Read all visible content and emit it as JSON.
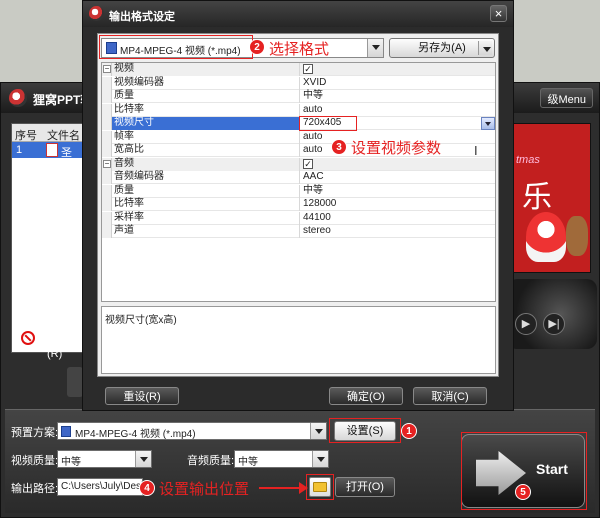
{
  "main": {
    "title": "狸窝PPT转",
    "menu_label": "级Menu",
    "file_list": {
      "columns": [
        "序号",
        "文件名"
      ],
      "rows": [
        {
          "index": "1",
          "name": "圣诞"
        }
      ]
    },
    "remove_label": "移除(R)",
    "preview": {
      "line1": "tmas",
      "line2": "乐"
    },
    "player": {
      "play": "▶",
      "next": "▶|"
    }
  },
  "bottom": {
    "preset_label": "预置方案:",
    "preset_value": "MP4-MPEG-4 视频 (*.mp4)",
    "settings_btn": "设置(S)",
    "video_quality_label": "视频质量:",
    "video_quality_value": "中等",
    "audio_quality_label": "音频质量:",
    "audio_quality_value": "中等",
    "output_path_label": "输出路径:",
    "output_path_value": "C:\\Users\\July\\Deskto",
    "open_btn": "打开(O)",
    "start_label": "Start"
  },
  "dialog": {
    "title": "输出格式设定",
    "close": "×",
    "format_value": "MP4-MPEG-4 视频 (*.mp4)",
    "saveas_label": "另存为(A)",
    "grid": [
      {
        "type": "cat",
        "name": "视频",
        "value": "✓"
      },
      {
        "type": "row",
        "name": "视频编码器",
        "value": "XVID"
      },
      {
        "type": "row",
        "name": "质量",
        "value": "中等"
      },
      {
        "type": "row",
        "name": "比特率",
        "value": "auto"
      },
      {
        "type": "sel",
        "name": "视频尺寸",
        "value": "720x405"
      },
      {
        "type": "row",
        "name": "帧率",
        "value": "auto"
      },
      {
        "type": "row",
        "name": "宽高比",
        "value": "auto"
      },
      {
        "type": "cat",
        "name": "音频",
        "value": "✓"
      },
      {
        "type": "row",
        "name": "音频编码器",
        "value": "AAC"
      },
      {
        "type": "row",
        "name": "质量",
        "value": "中等"
      },
      {
        "type": "row",
        "name": "比特率",
        "value": "128000"
      },
      {
        "type": "row",
        "name": "采样率",
        "value": "44100"
      },
      {
        "type": "row",
        "name": "声道",
        "value": "stereo"
      }
    ],
    "description": "视频尺寸(宽x高)",
    "reset_btn": "重设(R)",
    "ok_btn": "确定(O)",
    "cancel_btn": "取消(C)"
  },
  "annotations": {
    "m1": "1",
    "m2": "2",
    "t2": "选择格式",
    "m3": "3",
    "t3": "设置视频参数",
    "m4": "4",
    "t4": "设置输出位置",
    "m5": "5",
    "color": "#e52222"
  },
  "icons": {
    "folder": "folder-icon",
    "remove": "remove-icon",
    "logo": "app-logo-icon"
  }
}
